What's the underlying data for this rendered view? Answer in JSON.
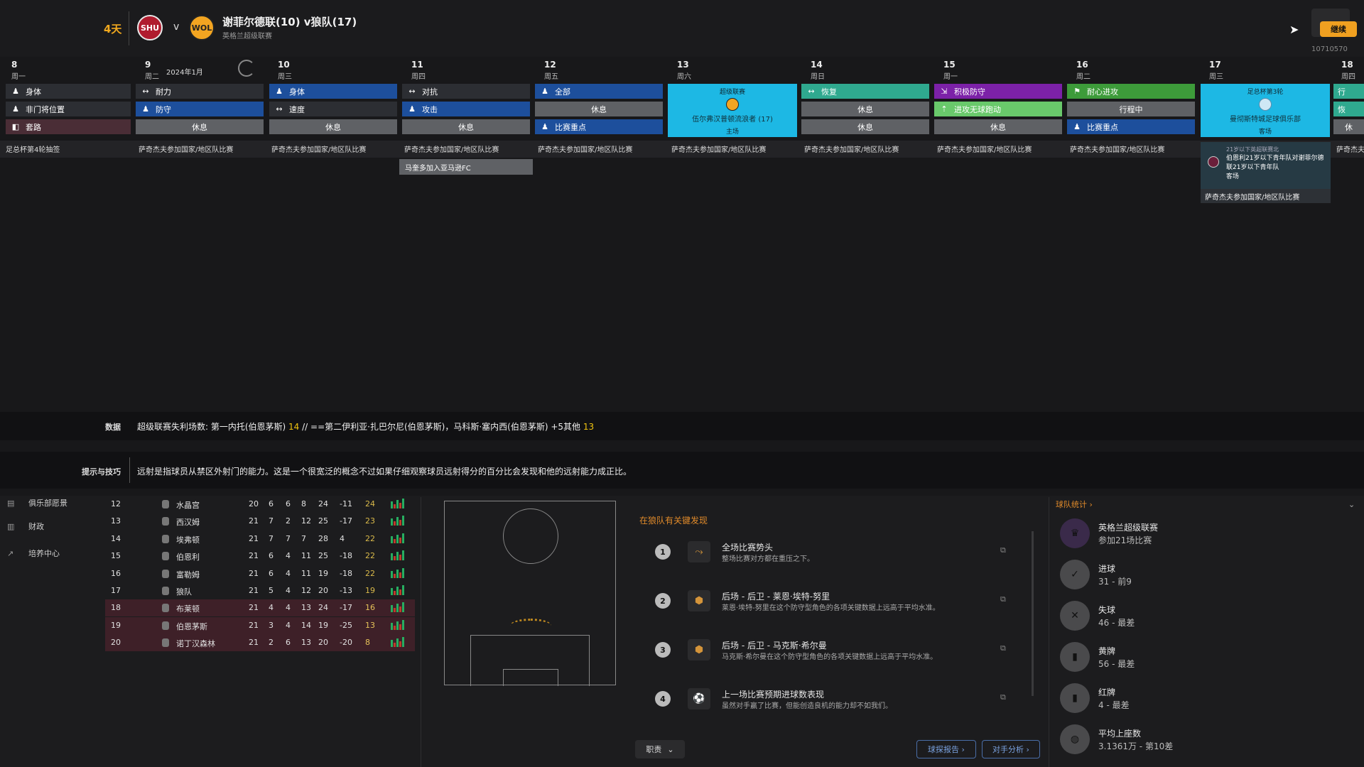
{
  "header": {
    "days_left": "4天",
    "vs": "v",
    "match_title": "谢菲尔德联(10) v狼队(17)",
    "competition": "英格兰超级联赛",
    "home_crest": "SHU",
    "away_crest": "WOL",
    "continue_label": "继续",
    "version": "10710570"
  },
  "calendar": {
    "month_label": "2024年1月",
    "days": [
      {
        "num": "8",
        "weekday": "周一"
      },
      {
        "num": "9",
        "weekday": "周二"
      },
      {
        "num": "10",
        "weekday": "周三"
      },
      {
        "num": "11",
        "weekday": "周四"
      },
      {
        "num": "12",
        "weekday": "周五"
      },
      {
        "num": "13",
        "weekday": "周六"
      },
      {
        "num": "14",
        "weekday": "周日"
      },
      {
        "num": "15",
        "weekday": "周一"
      },
      {
        "num": "16",
        "weekday": "周二"
      },
      {
        "num": "17",
        "weekday": "周三"
      },
      {
        "num": "18",
        "weekday": "周四"
      }
    ],
    "sessions": {
      "d8": [
        "身体",
        "非门将位置",
        "套路"
      ],
      "d9": [
        "耐力",
        "防守",
        "休息"
      ],
      "d10": [
        "身体",
        "速度",
        "休息"
      ],
      "d11": [
        "对抗",
        "攻击",
        "休息"
      ],
      "d12": [
        "全部",
        "休息",
        "比赛重点"
      ],
      "d14": [
        "恢复",
        "休息",
        "休息"
      ],
      "d15": [
        "积极防守",
        "进攻无球跑动",
        "休息"
      ],
      "d16": [
        "耐心进攻",
        "行程中",
        "比赛重点"
      ],
      "d18": [
        "行",
        "恢",
        "休"
      ]
    },
    "match13": {
      "comp": "超级联赛",
      "opponent": "伍尔弗汉普顿流浪者 (17)",
      "venue": "主场"
    },
    "match17": {
      "comp": "足总杯第3轮",
      "opponent": "曼彻斯特城足球俱乐部",
      "venue": "客场"
    },
    "events": [
      "足总杯第4轮抽签",
      "萨奇杰夫参加国家/地区队比赛",
      "萨奇杰夫参加国家/地区队比赛",
      "萨奇杰夫参加国家/地区队比赛",
      "萨奇杰夫参加国家/地区队比赛",
      "萨奇杰夫参加国家/地区队比赛",
      "萨奇杰夫参加国家/地区队比赛",
      "萨奇杰夫参加国家/地区队比赛",
      "萨奇杰夫参加国家/地区队比赛",
      "",
      "萨奇杰夫参"
    ],
    "extra_event": "马奎多加入亚马逊FC",
    "popup": {
      "title": "21岁以下英超联赛北",
      "text": "伯恩利21岁以下青年队对谢菲尔德联21岁以下青年队",
      "venue": "客场",
      "footer": "萨奇杰夫参加国家/地区队比赛"
    }
  },
  "databar": {
    "label": "数据",
    "text_a": "超级联赛失利场数: 第一内托(伯恩茅斯) ",
    "hl_a": "14",
    "text_b": " // ==第二伊利亚·扎巴尔尼(伯恩茅斯)，马科斯·塞内西(伯恩茅斯) +5其他 ",
    "hl_b": "13"
  },
  "tipbar": {
    "label": "提示与技巧",
    "text": "远射是指球员从禁区外射门的能力。这是一个很宽泛的概念不过如果仔细观察球员远射得分的百分比会发现和他的远射能力成正比。"
  },
  "nav": [
    {
      "label": "俱乐部愿景",
      "icon": "vision-icon"
    },
    {
      "label": "财政",
      "icon": "finance-icon"
    },
    {
      "label": "培养中心",
      "icon": "development-icon"
    }
  ],
  "table": [
    {
      "pos": "12",
      "team": "水晶宫",
      "p": "20",
      "w": "6",
      "d": "6",
      "l": "8",
      "f": "24",
      "gd": "-11",
      "pts": "24",
      "red": false
    },
    {
      "pos": "13",
      "team": "西汉姆",
      "p": "21",
      "w": "7",
      "d": "2",
      "l": "12",
      "f": "25",
      "gd": "-17",
      "pts": "23",
      "red": false
    },
    {
      "pos": "14",
      "team": "埃弗顿",
      "p": "21",
      "w": "7",
      "d": "7",
      "l": "7",
      "f": "28",
      "gd": "4",
      "pts": "22",
      "red": false
    },
    {
      "pos": "15",
      "team": "伯恩利",
      "p": "21",
      "w": "6",
      "d": "4",
      "l": "11",
      "f": "25",
      "gd": "-18",
      "pts": "22",
      "red": false
    },
    {
      "pos": "16",
      "team": "富勒姆",
      "p": "21",
      "w": "6",
      "d": "4",
      "l": "11",
      "f": "19",
      "gd": "-18",
      "pts": "22",
      "red": false
    },
    {
      "pos": "17",
      "team": "狼队",
      "p": "21",
      "w": "5",
      "d": "4",
      "l": "12",
      "f": "20",
      "gd": "-13",
      "pts": "19",
      "red": false
    },
    {
      "pos": "18",
      "team": "布莱顿",
      "p": "21",
      "w": "4",
      "d": "4",
      "l": "13",
      "f": "24",
      "gd": "-17",
      "pts": "16",
      "red": true
    },
    {
      "pos": "19",
      "team": "伯恩茅斯",
      "p": "21",
      "w": "3",
      "d": "4",
      "l": "14",
      "f": "19",
      "gd": "-25",
      "pts": "13",
      "red": true
    },
    {
      "pos": "20",
      "team": "诺丁汉森林",
      "p": "21",
      "w": "2",
      "d": "6",
      "l": "13",
      "f": "20",
      "gd": "-20",
      "pts": "8",
      "red": true
    }
  ],
  "findings": {
    "title": "在狼队有关键发现",
    "items": [
      {
        "n": "1",
        "head": "全场比赛势头",
        "desc": "整场比赛对方都在重压之下。",
        "icon": "momentum-icon"
      },
      {
        "n": "2",
        "head": "后场 - 后卫 - 莱恩·埃特-努里",
        "desc": "莱恩·埃特-努里在这个防守型角色的各项关键数据上远高于平均水准。",
        "icon": "defender-icon"
      },
      {
        "n": "3",
        "head": "后场 - 后卫 - 马克斯·希尔曼",
        "desc": "马克斯·希尔曼在这个防守型角色的各项关键数据上远高于平均水准。",
        "icon": "defender-icon"
      },
      {
        "n": "4",
        "head": "上一场比赛预期进球数表现",
        "desc": "虽然对手赢了比赛，但能创造良机的能力却不如我们。",
        "icon": "xg-icon"
      }
    ],
    "role_label": "职责",
    "scout_label": "球探报告",
    "opp_label": "对手分析"
  },
  "stats": {
    "title": "球队统计",
    "rows": [
      {
        "l1": "英格兰超级联赛",
        "l2": "参加21场比赛",
        "icon": "premier-league-icon"
      },
      {
        "l1": "进球",
        "l2": "31 - 前9",
        "icon": "goals-icon"
      },
      {
        "l1": "失球",
        "l2": "46 - 最差",
        "icon": "conceded-icon"
      },
      {
        "l1": "黄牌",
        "l2": "56 - 最差",
        "icon": "yellow-card-icon"
      },
      {
        "l1": "红牌",
        "l2": "4 - 最差",
        "icon": "red-card-icon"
      },
      {
        "l1": "平均上座数",
        "l2": "3.1361万 - 第10差",
        "icon": "attendance-icon"
      }
    ]
  },
  "colors": {
    "accent": "#f0a81e",
    "blue": "#1d4f9c",
    "match": "#1db8e4",
    "teal": "#2fa98f",
    "purple": "#7c21a8",
    "green": "#3d9b3a"
  }
}
